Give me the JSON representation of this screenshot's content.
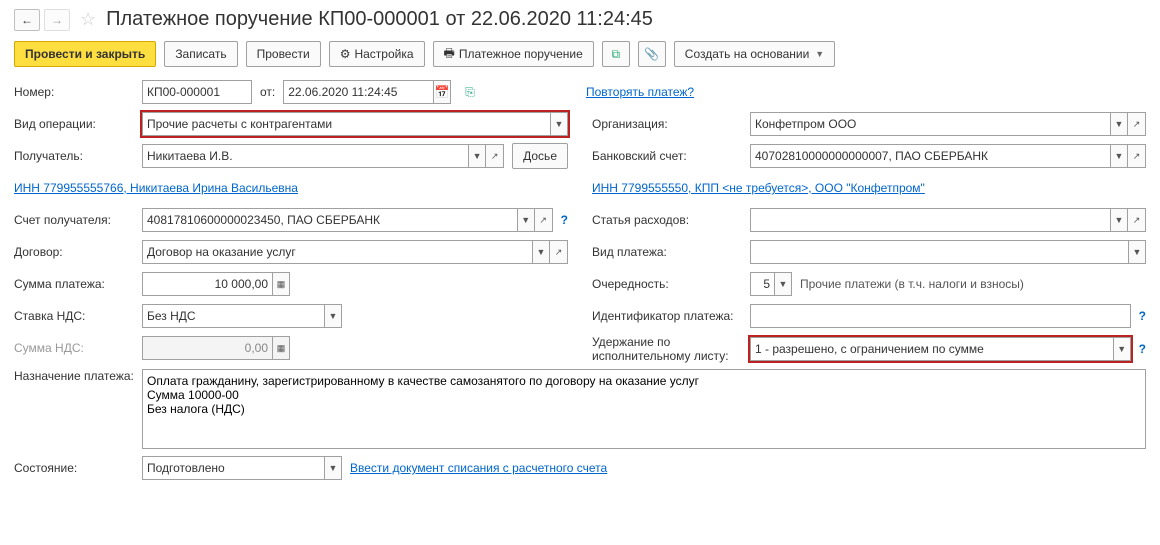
{
  "title": "Платежное поручение КП00-000001 от 22.06.2020 11:24:45",
  "toolbar": {
    "post_close": "Провести и закрыть",
    "save": "Записать",
    "post": "Провести",
    "settings": "Настройка",
    "print_payment": "Платежное поручение",
    "create_based": "Создать на основании"
  },
  "labels": {
    "number": "Номер:",
    "from": "от:",
    "repeat_link": "Повторять платеж?",
    "op_type": "Вид операции:",
    "organization": "Организация:",
    "recipient": "Получатель:",
    "dossier": "Досье",
    "bank_account": "Банковский счет:",
    "inn_left": "ИНН 779955555766, Никитаева Ирина Васильевна",
    "inn_right": "ИНН 7799555550, КПП <не требуется>, ООО \"Конфетпром\"",
    "recipient_account": "Счет получателя:",
    "expense_item": "Статья расходов:",
    "contract": "Договор:",
    "payment_type": "Вид платежа:",
    "payment_sum": "Сумма платежа:",
    "priority": "Очередность:",
    "priority_hint": "Прочие платежи (в т.ч. налоги и взносы)",
    "vat_rate": "Ставка НДС:",
    "payment_id": "Идентификатор платежа:",
    "vat_sum": "Сумма НДС:",
    "withholding": "Удержание по исполнительному листу:",
    "purpose": "Назначение платежа:",
    "state": "Состояние:",
    "enter_writeoff": "Ввести документ списания с расчетного счета"
  },
  "values": {
    "number": "КП00-000001",
    "date": "22.06.2020 11:24:45",
    "op_type": "Прочие расчеты с контрагентами",
    "organization": "Конфетпром ООО",
    "recipient": "Никитаева И.В.",
    "bank_account": "40702810000000000007, ПАО СБЕРБАНК",
    "recipient_account": "40817810600000023450, ПАО СБЕРБАНК",
    "expense_item": "",
    "contract": "Договор на оказание услуг",
    "payment_type": "",
    "payment_sum": "10 000,00",
    "priority": "5",
    "vat_rate": "Без НДС",
    "payment_id": "",
    "vat_sum": "0,00",
    "withholding": "1 - разрешено, с ограничением по сумме",
    "purpose": "Оплата гражданину, зарегистрированному в качестве самозанятого по договору на оказание услуг\nСумма 10000-00\nБез налога (НДС)",
    "state": "Подготовлено"
  }
}
